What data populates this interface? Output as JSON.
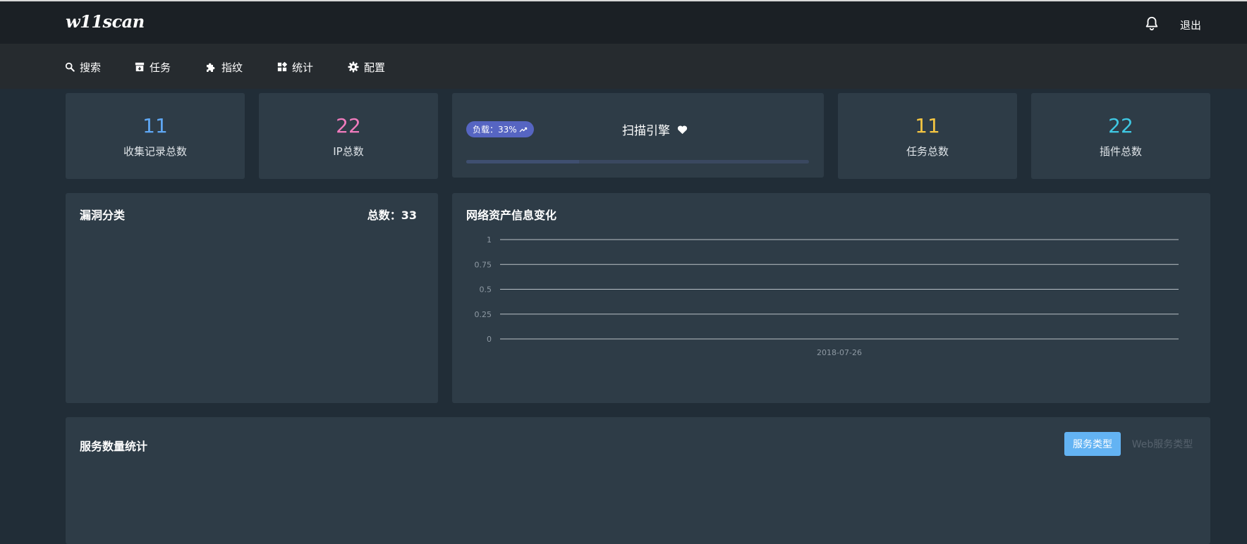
{
  "header": {
    "brand": "w11scan",
    "logout_label": "退出"
  },
  "nav": {
    "items": [
      {
        "label": "搜索",
        "icon": "search-icon"
      },
      {
        "label": "任务",
        "icon": "archive-icon"
      },
      {
        "label": "指纹",
        "icon": "puzzle-icon"
      },
      {
        "label": "统计",
        "icon": "dashboard-icon"
      },
      {
        "label": "配置",
        "icon": "gear-icon"
      }
    ]
  },
  "stats": {
    "records": {
      "value": "11",
      "label": "收集记录总数",
      "color": "#5fa8f4"
    },
    "ips": {
      "value": "22",
      "label": "IP总数",
      "color": "#f07bbd"
    },
    "tasks": {
      "value": "11",
      "label": "任务总数",
      "color": "#f4c542"
    },
    "plugins": {
      "value": "22",
      "label": "插件总数",
      "color": "#3fc8e3"
    }
  },
  "engine": {
    "badge": "负载：33%",
    "title": "扫描引擎",
    "load_percent": 33,
    "icon": "heart-icon"
  },
  "vuln_panel": {
    "title": "漏洞分类",
    "total_label": "总数：33"
  },
  "asset_panel": {
    "title": "网络资产信息变化"
  },
  "chart_data": {
    "type": "line",
    "title": "",
    "x": [
      "2018-07-26"
    ],
    "yticks": [
      "1",
      "0.75",
      "0.5",
      "0.25",
      "0"
    ],
    "ylim": [
      0,
      1
    ],
    "series": [],
    "grid": true
  },
  "service_panel": {
    "title": "服务数量统计",
    "btn_service_type": "服务类型",
    "btn_web_service_type": "Web服务类型"
  }
}
